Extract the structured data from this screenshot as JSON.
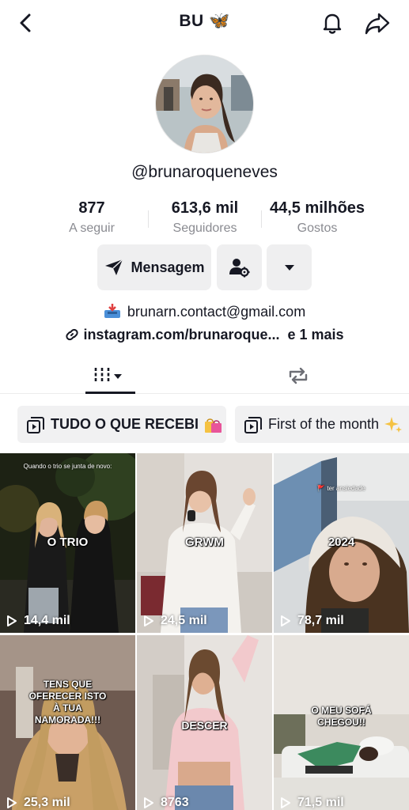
{
  "header": {
    "title": "BU 🦋"
  },
  "profile": {
    "username": "@brunaroqueneves",
    "stats": [
      {
        "value": "877",
        "label": "A seguir"
      },
      {
        "value": "613,6 mil",
        "label": "Seguidores"
      },
      {
        "value": "44,5 milhões",
        "label": "Gostos"
      }
    ],
    "message_button": "Mensagem",
    "email": "brunarn.contact@gmail.com",
    "link": "instagram.com/brunaroque...",
    "link_more": "e 1 mais"
  },
  "playlists": [
    {
      "label": "TUDO O QUE RECEBI"
    },
    {
      "label": "First of the month"
    }
  ],
  "videos": [
    {
      "caption": "O TRIO",
      "small_text": "Quando o trio se junta de novo:",
      "views": "14,4 mil"
    },
    {
      "caption": "GRWM",
      "views": "24,5 mil"
    },
    {
      "caption": "2024",
      "small_text": "🚩 ter ansiedade",
      "views": "78,7 mil"
    },
    {
      "caption": "TENS QUE OFERECER ISTO À TUA NAMORADA!!!",
      "views": "25,3 mil"
    },
    {
      "caption": "DESCER",
      "views": "8763"
    },
    {
      "caption": "O MEU SOFÁ CHEGOU!!",
      "views": "71,5 mil"
    }
  ],
  "colors": {
    "text": "#161823",
    "secondary": "#8a8b91",
    "button_bg": "#efeff0"
  }
}
